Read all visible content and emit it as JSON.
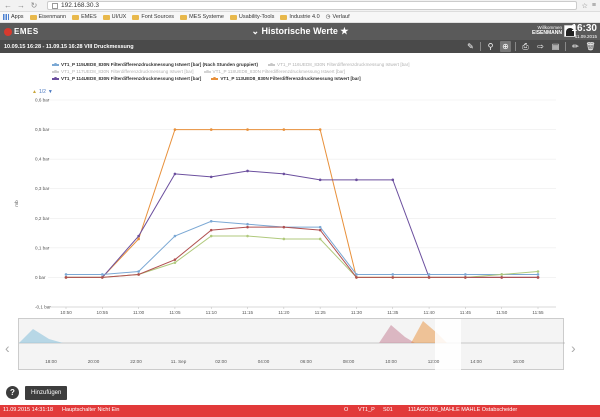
{
  "browser": {
    "url": "192.168.30.3",
    "bookmarks": [
      "Apps",
      "Eisenmann",
      "EMES",
      "UI/UX",
      "Font Sources",
      "MES Systeme",
      "Usability-Tools",
      "Industrie 4.0",
      "Verlauf"
    ]
  },
  "app": {
    "logo_text": "EMES",
    "title": "Historische Werte",
    "user_greeting": "Willkommen",
    "user_name": "EISENMANN",
    "time": "16:30",
    "date": "11.09.2015"
  },
  "toolbar": {
    "range": "10.09.15 16:28 - 11.09.15 16:28   VIII Druckmessung"
  },
  "legend": [
    {
      "label": "VT1_P 115UED8_830N Filterdifferenzdruckmessung Istwert [bar] (Nach Stunden gruppiert)",
      "color": "#7ba8d4"
    },
    {
      "label": "VT1_P 116UED8_830N Filterdifferenzdruckmessung Istwert [bar]",
      "color": "#c8c8c8"
    },
    {
      "label": "VT1_P 117UED8_830N Filterdifferenzdruckmessung Istwert [bar]",
      "color": "#cfcfcf"
    },
    {
      "label": "VT1_P 118UED8_830N Filterdifferenzdruckmessung Istwert [bar]",
      "color": "#d4d4d4"
    },
    {
      "label": "VT1_P 114UED8_830N Filterdifferenzdruckmessung Istwert [bar]",
      "color": "#6b4f9e"
    },
    {
      "label": "VT1_P 113UED8_830N Filterdifferenzdruckmessung Istwert [bar]",
      "color": "#e8903a"
    }
  ],
  "legend_pager": "1/2",
  "chart_data": {
    "type": "line",
    "ylabel": "mb",
    "ylim": [
      -0.1,
      0.6
    ],
    "yticks": [
      "0,6 bar",
      "0,5 bar",
      "0,4 bar",
      "0,3 bar",
      "0,2 bar",
      "0,1 bar",
      "0 bar",
      "-0,1 bar"
    ],
    "x": [
      "10:50",
      "10:55",
      "11:00",
      "11:05",
      "11:10",
      "11:15",
      "11:20",
      "11:25",
      "11:30",
      "11:35",
      "11:40",
      "11:45",
      "11:50",
      "11:55"
    ],
    "series": [
      {
        "name": "VT1_P 113UED8_830N",
        "color": "#e8903a",
        "values": [
          0.0,
          0.0,
          0.13,
          0.5,
          0.5,
          0.5,
          0.5,
          0.5,
          0.0,
          0.0,
          0.0,
          0.0,
          0.0,
          0.0
        ]
      },
      {
        "name": "VT1_P 114UED8_830N",
        "color": "#6b4f9e",
        "values": [
          0.0,
          0.0,
          0.14,
          0.35,
          0.34,
          0.36,
          0.35,
          0.33,
          0.33,
          0.33,
          0.0,
          0.0,
          0.0,
          0.0
        ]
      },
      {
        "name": "VT1_P 115UED8_830N",
        "color": "#7ba8d4",
        "values": [
          0.01,
          0.01,
          0.02,
          0.14,
          0.19,
          0.18,
          0.17,
          0.17,
          0.01,
          0.01,
          0.01,
          0.01,
          0.01,
          0.01
        ]
      },
      {
        "name": "VT1_P 116UED8_830N",
        "color": "#b0c97c",
        "values": [
          0.0,
          0.0,
          0.01,
          0.05,
          0.14,
          0.14,
          0.13,
          0.13,
          0.0,
          0.0,
          0.0,
          0.0,
          0.01,
          0.02
        ]
      },
      {
        "name": "VT1_P 117UED8_830N",
        "color": "#b05050",
        "values": [
          0.0,
          0.0,
          0.01,
          0.06,
          0.16,
          0.17,
          0.17,
          0.16,
          0.0,
          0.0,
          0.0,
          0.0,
          0.0,
          0.0
        ]
      }
    ]
  },
  "navigator": {
    "labels": [
      "18:00",
      "20:00",
      "22:00",
      "11. Sep",
      "02:00",
      "04:00",
      "06:00",
      "08:00",
      "10:00",
      "12:00",
      "14:00",
      "16:00"
    ]
  },
  "buttons": {
    "add": "Hinzufügen"
  },
  "status": {
    "datetime": "11.09.2015 14:31:18",
    "message": "Hauptschalter Nicht Ein",
    "code": "O",
    "unit": "VT1_P",
    "number": "S01",
    "component": "111AGO189_MAHLE   MAHLE Ostabscheider"
  }
}
